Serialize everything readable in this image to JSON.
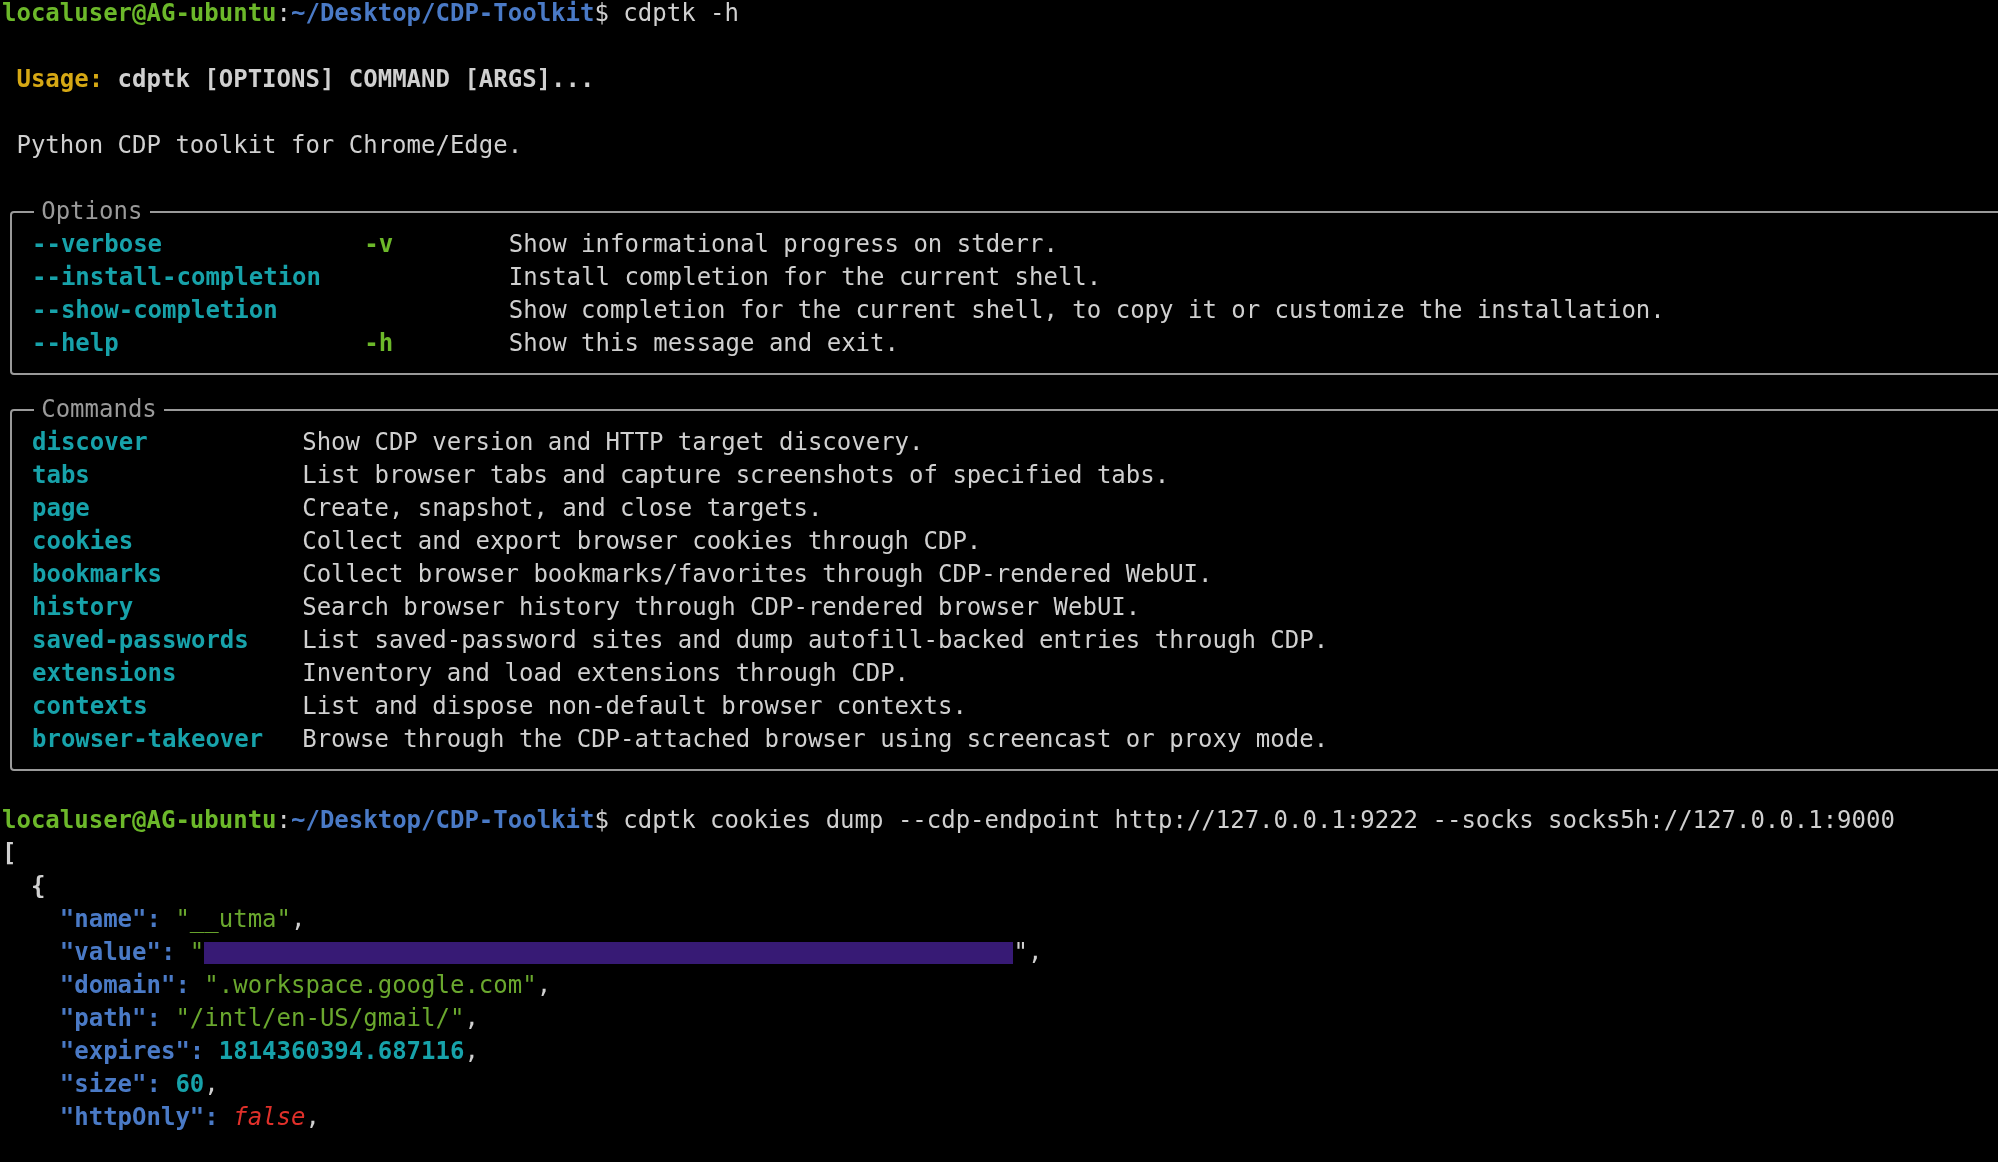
{
  "prompts": [
    {
      "user_host": "localuser@AG-ubuntu",
      "separator": ":",
      "path": "~/Desktop/CDP-Toolkit",
      "symbol": "$",
      "command": " cdptk -h"
    },
    {
      "user_host": "localuser@AG-ubuntu",
      "separator": ":",
      "path": "~/Desktop/CDP-Toolkit",
      "symbol": "$",
      "command": " cdptk cookies dump --cdp-endpoint http://127.0.0.1:9222 --socks socks5h://127.0.0.1:9000"
    }
  ],
  "usage": {
    "label": "Usage:",
    "text": "cdptk [OPTIONS] COMMAND [ARGS]..."
  },
  "description": "Python CDP toolkit for Chrome/Edge.",
  "options_panel": {
    "title": "Options",
    "items": [
      {
        "name": "--verbose",
        "short": "-v",
        "description": "Show informational progress on stderr."
      },
      {
        "name": "--install-completion",
        "description": "Install completion for the current shell."
      },
      {
        "name": "--show-completion",
        "description": "Show completion for the current shell, to copy it or customize the installation."
      },
      {
        "name": "--help",
        "short": "-h",
        "description": "Show this message and exit."
      }
    ]
  },
  "commands_panel": {
    "title": "Commands",
    "items": [
      {
        "name": "discover",
        "description": "Show CDP version and HTTP target discovery."
      },
      {
        "name": "tabs",
        "description": "List browser tabs and capture screenshots of specified tabs."
      },
      {
        "name": "page",
        "description": "Create, snapshot, and close targets."
      },
      {
        "name": "cookies",
        "description": "Collect and export browser cookies through CDP."
      },
      {
        "name": "bookmarks",
        "description": "Collect browser bookmarks/favorites through CDP-rendered WebUI."
      },
      {
        "name": "history",
        "description": "Search browser history through CDP-rendered browser WebUI."
      },
      {
        "name": "saved-passwords",
        "description": "List saved-password sites and dump autofill-backed entries through CDP."
      },
      {
        "name": "extensions",
        "description": "Inventory and load extensions through CDP."
      },
      {
        "name": "contexts",
        "description": "List and dispose non-default browser contexts."
      },
      {
        "name": "browser-takeover",
        "description": "Browse through the CDP-attached browser using screencast or proxy mode."
      }
    ]
  },
  "output": {
    "open_bracket": "[",
    "open_brace": "{",
    "entries": [
      {
        "key": "\"name\":",
        "kind": "string",
        "value": "\"__utma\"",
        "trail": ","
      },
      {
        "key": "\"value\":",
        "kind": "redacted",
        "value_open": "\"",
        "value_close": "\","
      },
      {
        "key": "\"domain\":",
        "kind": "string",
        "value": "\".workspace.google.com\"",
        "trail": ","
      },
      {
        "key": "\"path\":",
        "kind": "string",
        "value": "\"/intl/en-US/gmail/\"",
        "trail": ","
      },
      {
        "key": "\"expires\":",
        "kind": "number",
        "value": "1814360394.687116",
        "trail": ","
      },
      {
        "key": "\"size\":",
        "kind": "number",
        "value": "60",
        "trail": ","
      },
      {
        "key": "\"httpOnly\":",
        "kind": "boolean",
        "value": "false",
        "trail": ","
      }
    ]
  }
}
